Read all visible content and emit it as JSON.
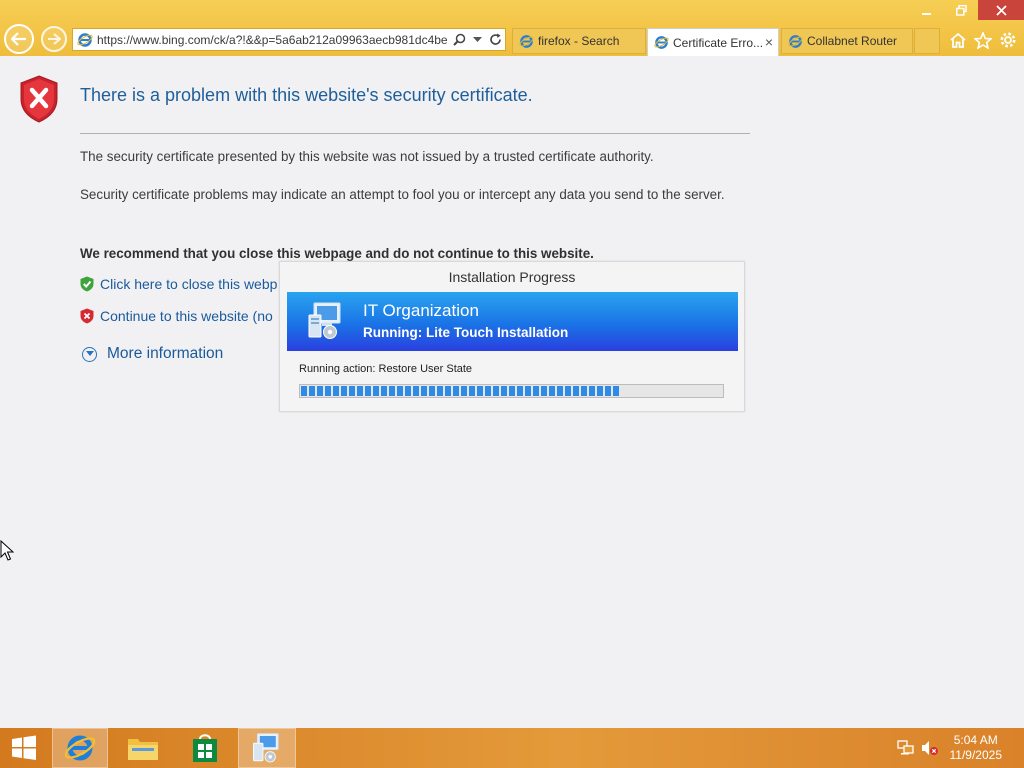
{
  "browser": {
    "url": "https://www.bing.com/ck/a?!&&p=5a6ab212a09963aecb981dc4be",
    "tabs": [
      {
        "label": "firefox - Search",
        "active": false
      },
      {
        "label": "Certificate Erro...",
        "active": true,
        "close": "×"
      },
      {
        "label": "Collabnet Router",
        "active": false
      }
    ]
  },
  "page": {
    "title": "There is a problem with this website's security certificate.",
    "para1": "The security certificate presented by this website was not issued by a trusted certificate authority.",
    "para2": "Security certificate problems may indicate an attempt to fool you or intercept any data you send to the server.",
    "recommend": "We recommend that you close this webpage and do not continue to this website.",
    "link_close": "Click here to close this webp",
    "link_continue": "Continue to this website (no",
    "more_info": "More information"
  },
  "dialog": {
    "title": "Installation Progress",
    "org": "IT Organization",
    "running": "Running: Lite Touch Installation",
    "action": "Running action: Restore User State",
    "progress_fraction": 0.755
  },
  "taskbar": {
    "time": "5:04 AM",
    "date": "11/9/2025"
  },
  "colors": {
    "chrome_gold": "#efbd3c",
    "link_blue": "#1a5a9c",
    "banner_blue": "#1a73e6",
    "taskbar_orange": "#e49a3a"
  }
}
